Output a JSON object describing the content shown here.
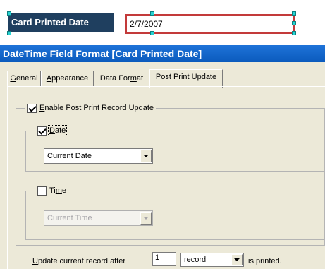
{
  "designer": {
    "label_text": "Card Printed Date",
    "value_text": "2/7/2007"
  },
  "dialog": {
    "title": "DateTime Field Format [Card Printed Date]",
    "tabs": [
      {
        "label_u": "G",
        "label_rest": "eneral"
      },
      {
        "label_u": "A",
        "label_rest": "ppearance"
      },
      {
        "label_pre": "Data For",
        "label_u": "m",
        "label_rest": "at"
      },
      {
        "label_pre": "Pos",
        "label_u": "t",
        "label_rest": " Print Update"
      }
    ],
    "enable_group": {
      "label_u": "E",
      "label_rest": "nable Post Print Record Update",
      "checked": true
    },
    "date_group": {
      "label_u": "D",
      "label_rest": "ate",
      "checked": true,
      "select_value": "Current Date"
    },
    "time_group": {
      "label_pre": "Ti",
      "label_u": "m",
      "label_rest": "e",
      "checked": false,
      "select_value": "Current Time"
    },
    "update_row": {
      "prefix_u": "U",
      "prefix_rest": "pdate current record after",
      "count_value": "1",
      "unit_value": "record",
      "suffix": "is printed."
    }
  },
  "colors": {
    "title_bar": "#0b5bbd",
    "designer_label_bg": "#1f3f5f",
    "selection_border": "#c33a3a",
    "handles": "#26d3d3",
    "dialog_bg": "#ece9d8"
  }
}
